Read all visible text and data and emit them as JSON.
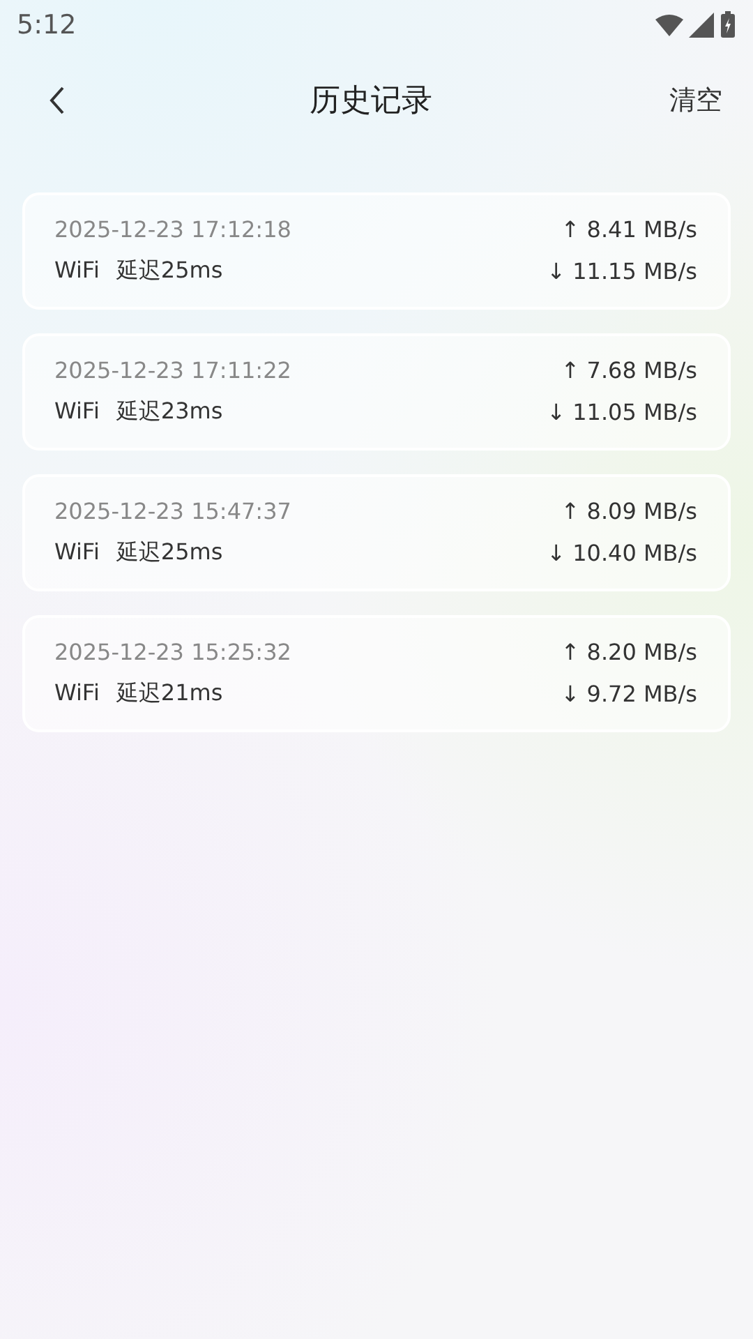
{
  "status_bar": {
    "time": "5:12"
  },
  "header": {
    "title": "历史记录",
    "action": "清空"
  },
  "records": [
    {
      "time": "2025-12-23 17:12:18",
      "network": "WiFi",
      "latency": "延迟25ms",
      "upload": "↑ 8.41 MB/s",
      "download": "↓ 11.15 MB/s"
    },
    {
      "time": "2025-12-23 17:11:22",
      "network": "WiFi",
      "latency": "延迟23ms",
      "upload": "↑ 7.68 MB/s",
      "download": "↓ 11.05 MB/s"
    },
    {
      "time": "2025-12-23 15:47:37",
      "network": "WiFi",
      "latency": "延迟25ms",
      "upload": "↑ 8.09 MB/s",
      "download": "↓ 10.40 MB/s"
    },
    {
      "time": "2025-12-23 15:25:32",
      "network": "WiFi",
      "latency": "延迟21ms",
      "upload": "↑ 8.20 MB/s",
      "download": "↓ 9.72 MB/s"
    }
  ]
}
